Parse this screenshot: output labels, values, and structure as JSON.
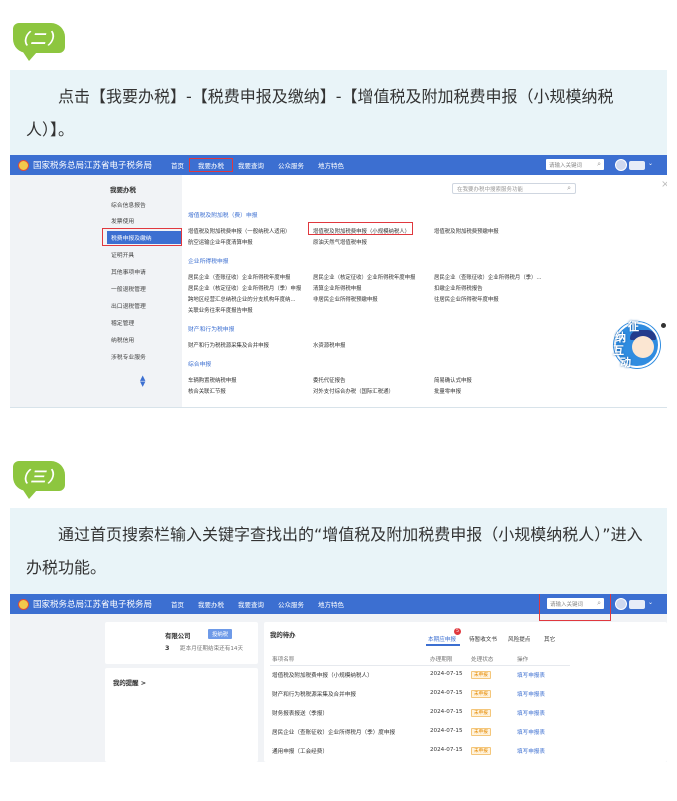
{
  "section2": {
    "badge": "（二）",
    "instruction": "点击【我要办税】-【税费申报及缴纳】-【增值税及附加税费申报（小规模纳税人）】。"
  },
  "section3": {
    "badge": "（三）",
    "instruction": "通过首页搜索栏输入关键字查找出的“增值税及附加税费申报（小规模纳税人）”进入办税功能。"
  },
  "shot1": {
    "site_title": "国家税务总局江苏省电子税务局",
    "nav": [
      "首页",
      "我要办税",
      "我要查询",
      "公众服务",
      "地方特色"
    ],
    "search_placeholder": "请输入关键词",
    "content_search_placeholder": "在我要办税中搜索服务功能",
    "sidebar_title": "我要办税",
    "sidebar_items": [
      "综合信息报告",
      "发票使用",
      "税费申报及缴纳",
      "证明开具",
      "其他事项申请",
      "一般退税管理",
      "出口退税管理",
      "稽定管理",
      "纳税信用",
      "涉税专业服务"
    ],
    "sections": [
      {
        "title": "增值税及附加税（费）申报",
        "links": [
          [
            "增值税及附加税费申报（一般纳税人适用）",
            "增值税及附加税费申报（小规模纳税人）",
            "增值税及附加税费预缴申报"
          ],
          [
            "航空运输企业年度清算申报",
            "原油天然气增值税申报",
            ""
          ]
        ]
      },
      {
        "title": "企业所得税申报",
        "links": [
          [
            "居民企业（查账征收）企业所得税年度申报",
            "居民企业（核定征收）企业所得税年度申报",
            "居民企业（查账征收）企业所得税月（季）..."
          ],
          [
            "居民企业（核定征收）企业所得税月（季）申报",
            "清算企业所得税申报",
            "扣缴企业所得税报告"
          ],
          [
            "跨地区经营汇总纳税企业的分支机构年度纳...",
            "非居民企业所得税预缴申报",
            "往居民企业所得税年度申报"
          ],
          [
            "关联业务往来年度报告申报",
            "",
            ""
          ]
        ]
      },
      {
        "title": "财产和行为税申报",
        "links": [
          [
            "财产和行为税税源采集及合并申报",
            "水资源税申报",
            ""
          ]
        ]
      },
      {
        "title": "综合申报",
        "links": [
          [
            "车辆购置税纳税申报",
            "委托代征报告",
            "简易确认式申报"
          ],
          [
            "核合关联汇节报",
            "对外支付综合办税（国际汇税通）",
            "批量零申报"
          ]
        ]
      }
    ],
    "mascot_chars": [
      "征",
      "纳",
      "互",
      "动"
    ]
  },
  "shot2": {
    "site_title": "国家税务总局江苏省电子税务局",
    "nav": [
      "首页",
      "我要办税",
      "我要查询",
      "公众服务",
      "地方特色"
    ],
    "search_placeholder": "请输入关键词",
    "company": "有限公司",
    "role_btn": "投纳税",
    "deadline_count": "3",
    "deadline_text": "距本月征期结束还有14天",
    "reminder_title": "我的提醒 >",
    "todo_title": "我的待办",
    "tabs": [
      "本期应申报",
      "待暂收文书",
      "风险提点",
      "其它"
    ],
    "tab_badge": "5",
    "table_headers": [
      "事项名称",
      "办理期限",
      "处理状态",
      "操作"
    ],
    "rows": [
      {
        "name": "增值税及附加税费申报（小规模纳税人）",
        "date": "2024-07-15",
        "status": "未申报",
        "action": "填写申报表"
      },
      {
        "name": "财产和行为税税源采集及合并申报",
        "date": "2024-07-15",
        "status": "未申报",
        "action": "填写申报表"
      },
      {
        "name": "财务报表报送（季报）",
        "date": "2024-07-15",
        "status": "未申报",
        "action": "填写申报表"
      },
      {
        "name": "居民企业（查账征收）企业所得税月（季）度申报",
        "date": "2024-07-15",
        "status": "未申报",
        "action": "填写申报表"
      },
      {
        "name": "通用申报（工会经费）",
        "date": "2024-07-15",
        "status": "未申报",
        "action": "填写申报表"
      }
    ]
  },
  "colors": {
    "badge_green": "#8dc63f",
    "panel_bg": "#e9f4f8",
    "brand_blue": "#3c6fd1",
    "highlight_red": "#e0383e"
  }
}
